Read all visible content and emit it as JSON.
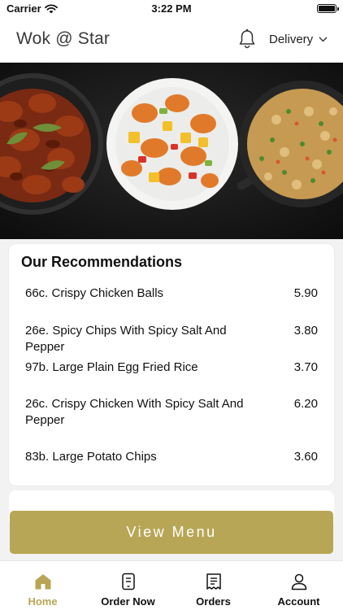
{
  "status_bar": {
    "carrier": "Carrier",
    "time": "3:22 PM"
  },
  "header": {
    "title": "Wok @ Star",
    "delivery_mode": "Delivery"
  },
  "recommendations": {
    "title": "Our Recommendations",
    "items": [
      {
        "name": "66c. Crispy Chicken Balls",
        "price": "5.90"
      },
      {
        "name": "26e. Spicy Chips With Spicy Salt And Pepper",
        "price": "3.80"
      },
      {
        "name": "97b. Large Plain Egg Fried Rice",
        "price": "3.70"
      },
      {
        "name": "26c. Crispy Chicken With Spicy Salt And Pepper",
        "price": "6.20"
      },
      {
        "name": "83b. Large Potato Chips",
        "price": "3.60"
      }
    ]
  },
  "view_menu_label": "View Menu",
  "nav": {
    "items": [
      {
        "label": "Home",
        "icon": "home-icon",
        "active": true
      },
      {
        "label": "Order Now",
        "icon": "order-icon",
        "active": false
      },
      {
        "label": "Orders",
        "icon": "receipt-icon",
        "active": false
      },
      {
        "label": "Account",
        "icon": "person-icon",
        "active": false
      }
    ]
  },
  "colors": {
    "accent": "#b7a655",
    "background": "#f2f2f2",
    "hero_bg": "#141414"
  }
}
